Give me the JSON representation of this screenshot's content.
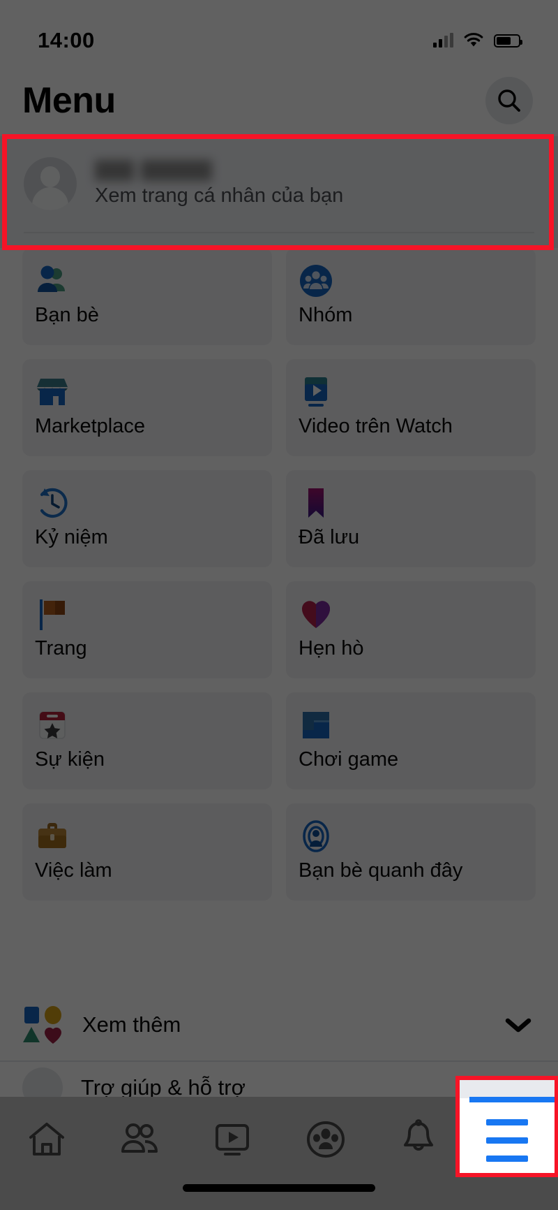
{
  "status_bar": {
    "time": "14:00",
    "signal_icon": "cellular-signal-icon",
    "wifi_icon": "wifi-icon",
    "battery_icon": "battery-icon"
  },
  "header": {
    "title": "Menu",
    "search_icon": "search-icon"
  },
  "profile": {
    "name": "",
    "subtitle": "Xem trang cá nhân của bạn",
    "avatar_icon": "avatar-placeholder-icon",
    "highlight_color": "#f61427"
  },
  "shortcuts": [
    {
      "label": "Bạn bè",
      "icon": "friends-icon"
    },
    {
      "label": "Nhóm",
      "icon": "groups-icon"
    },
    {
      "label": "Marketplace",
      "icon": "marketplace-icon"
    },
    {
      "label": "Video trên Watch",
      "icon": "watch-video-icon"
    },
    {
      "label": "Kỷ niệm",
      "icon": "memories-clock-icon"
    },
    {
      "label": "Đã lưu",
      "icon": "saved-bookmark-icon"
    },
    {
      "label": "Trang",
      "icon": "pages-flag-icon"
    },
    {
      "label": "Hẹn hò",
      "icon": "dating-heart-icon"
    },
    {
      "label": "Sự kiện",
      "icon": "events-calendar-icon"
    },
    {
      "label": "Chơi game",
      "icon": "gaming-icon"
    },
    {
      "label": "Việc làm",
      "icon": "jobs-briefcase-icon"
    },
    {
      "label": "Bạn bè quanh đây",
      "icon": "nearby-friends-icon"
    }
  ],
  "see_more": {
    "label": "Xem thêm",
    "icon": "shapes-cluster-icon",
    "chevron_icon": "chevron-down-icon"
  },
  "next_row": {
    "label": "Trợ giúp & hỗ trợ",
    "icon": "help-support-icon"
  },
  "bottom_nav": {
    "items": [
      {
        "name": "home",
        "icon": "home-icon",
        "active": false
      },
      {
        "name": "friends",
        "icon": "friends-outline-icon",
        "active": false
      },
      {
        "name": "watch",
        "icon": "watch-play-icon",
        "active": false
      },
      {
        "name": "groups",
        "icon": "groups-outline-icon",
        "active": false
      },
      {
        "name": "notifications",
        "icon": "bell-icon",
        "active": false
      },
      {
        "name": "menu",
        "icon": "hamburger-menu-icon",
        "active": true
      }
    ],
    "active_color": "#1877f2",
    "highlight_color": "#f61427"
  },
  "colors": {
    "accent": "#1877f2",
    "highlight": "#f61427",
    "tile_bg": "#f1f2f5",
    "profile_bg": "#eff1f5",
    "dim": "rgba(0,0,0,0.62)"
  }
}
